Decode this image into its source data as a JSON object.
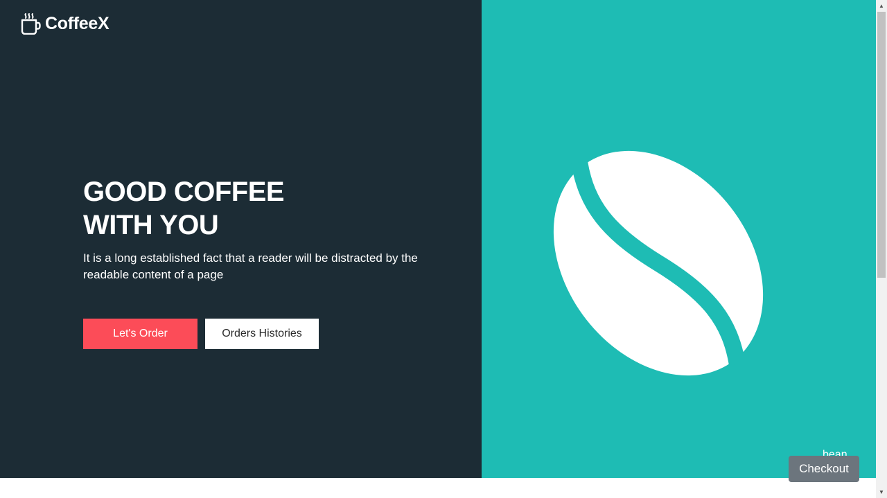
{
  "brand": {
    "name": "CoffeeX",
    "icon": "coffee-cup-icon"
  },
  "hero": {
    "title_line1": "GOOD COFFEE",
    "title_line2": "WITH YOU",
    "description": "It is a long established fact that a reader will be distracted by the readable content of a page"
  },
  "buttons": {
    "order_label": "Let's Order",
    "history_label": "Orders Histories"
  },
  "illustration": {
    "icon": "coffee-bean-icon",
    "caption": "bean"
  },
  "checkout": {
    "label": "Checkout"
  },
  "colors": {
    "dark_panel": "#1c2c35",
    "teal_panel": "#1ebcb4",
    "accent_red": "#fc4c58",
    "checkout_gray": "#6c757d"
  }
}
